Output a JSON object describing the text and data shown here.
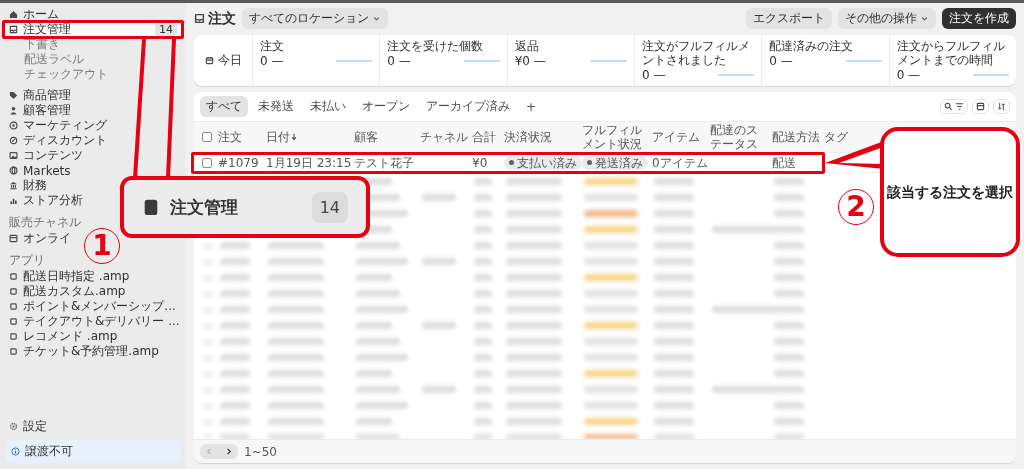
{
  "sidebar": {
    "items": [
      {
        "label": "ホーム",
        "selected": false
      },
      {
        "label": "注文管理",
        "selected": true,
        "badge": "14",
        "children": [
          {
            "label": "下書き",
            "selected": false
          },
          {
            "label": "配送ラベル",
            "selected": false
          },
          {
            "label": "チェックアウト",
            "selected": false
          }
        ]
      },
      {
        "label": "商品管理",
        "selected": false
      },
      {
        "label": "顧客管理",
        "selected": false
      },
      {
        "label": "マーケティング",
        "selected": false
      },
      {
        "label": "ディスカウント",
        "selected": false
      },
      {
        "label": "コンテンツ",
        "selected": false
      },
      {
        "label": "Markets",
        "selected": false
      },
      {
        "label": "財務",
        "selected": false
      },
      {
        "label": "ストア分析",
        "selected": false
      }
    ],
    "sales_channels": {
      "heading": "販売チャネル",
      "items": [
        {
          "label": "オンライ",
          "selected": false
        }
      ]
    },
    "apps": {
      "heading": "アプリ",
      "items": [
        {
          "label": "配送日時指定 .amp",
          "selected": false
        },
        {
          "label": "配送カスタム.amp",
          "selected": false
        },
        {
          "label": "ポイント&メンバーシップ...",
          "selected": false
        },
        {
          "label": "テイクアウト&デリバリー ...",
          "selected": false
        },
        {
          "label": "レコメンド .amp",
          "selected": false
        },
        {
          "label": "チケット&予約管理.amp",
          "selected": false
        }
      ]
    },
    "settings": "設定",
    "store_status": "譲渡不可"
  },
  "header": {
    "title": "注文",
    "location_filter": "すべてのロケーション",
    "buttons": [
      {
        "label": "エクスポート",
        "kind": "secondary"
      },
      {
        "label": "その他の操作",
        "kind": "menu"
      },
      {
        "label": "注文を作成",
        "kind": "primary"
      }
    ]
  },
  "stats": {
    "period": "今日",
    "metrics": [
      {
        "label": "注文",
        "value": "0 —"
      },
      {
        "label": "注文を受けた個数",
        "value": "0 —"
      },
      {
        "label": "返品",
        "value": "¥0 —"
      },
      {
        "label": "注文がフルフィルメントされました",
        "value": "0 —"
      },
      {
        "label": "配達済みの注文",
        "value": "0 —"
      },
      {
        "label": "注文からフルフィルメントまでの時間",
        "value": "0 —"
      }
    ]
  },
  "orders": {
    "tabs": [
      {
        "label": "すべて",
        "selected": true
      },
      {
        "label": "未発送",
        "selected": false
      },
      {
        "label": "未払い",
        "selected": false
      },
      {
        "label": "オープン",
        "selected": false
      },
      {
        "label": "アーカイブ済み",
        "selected": false
      }
    ],
    "add_tab": "+",
    "select_all": {
      "checked": false
    },
    "columns": [
      {
        "label": "注文",
        "sorted": false
      },
      {
        "label": "日付",
        "sorted": true
      },
      {
        "label": "顧客",
        "sorted": false
      },
      {
        "label": "チャネル",
        "sorted": false
      },
      {
        "label": "合計",
        "sorted": false
      },
      {
        "label": "決済状況",
        "sorted": false
      },
      {
        "label": "フルフィルメント状況",
        "sorted": false
      },
      {
        "label": "アイテム",
        "sorted": false
      },
      {
        "label": "配達のステータス",
        "sorted": false
      },
      {
        "label": "配送方法",
        "sorted": false
      },
      {
        "label": "タグ",
        "sorted": false
      }
    ],
    "rows": [
      {
        "checked": false,
        "order": "#1079",
        "date": "1月19日 23:15",
        "customer": "テスト花子",
        "total": "¥0",
        "payment_status": "支払い済み",
        "fulfillment_status": "発送済み",
        "items": "0アイテム",
        "delivery_method": "配送"
      }
    ],
    "pagination": {
      "previous_disabled": true,
      "range": "1~50"
    }
  },
  "annotations": {
    "callout_1": {
      "marker": "1",
      "label": "注文管理",
      "count": "14"
    },
    "callout_2": {
      "marker": "2",
      "text": "該当する注文を選択"
    }
  }
}
